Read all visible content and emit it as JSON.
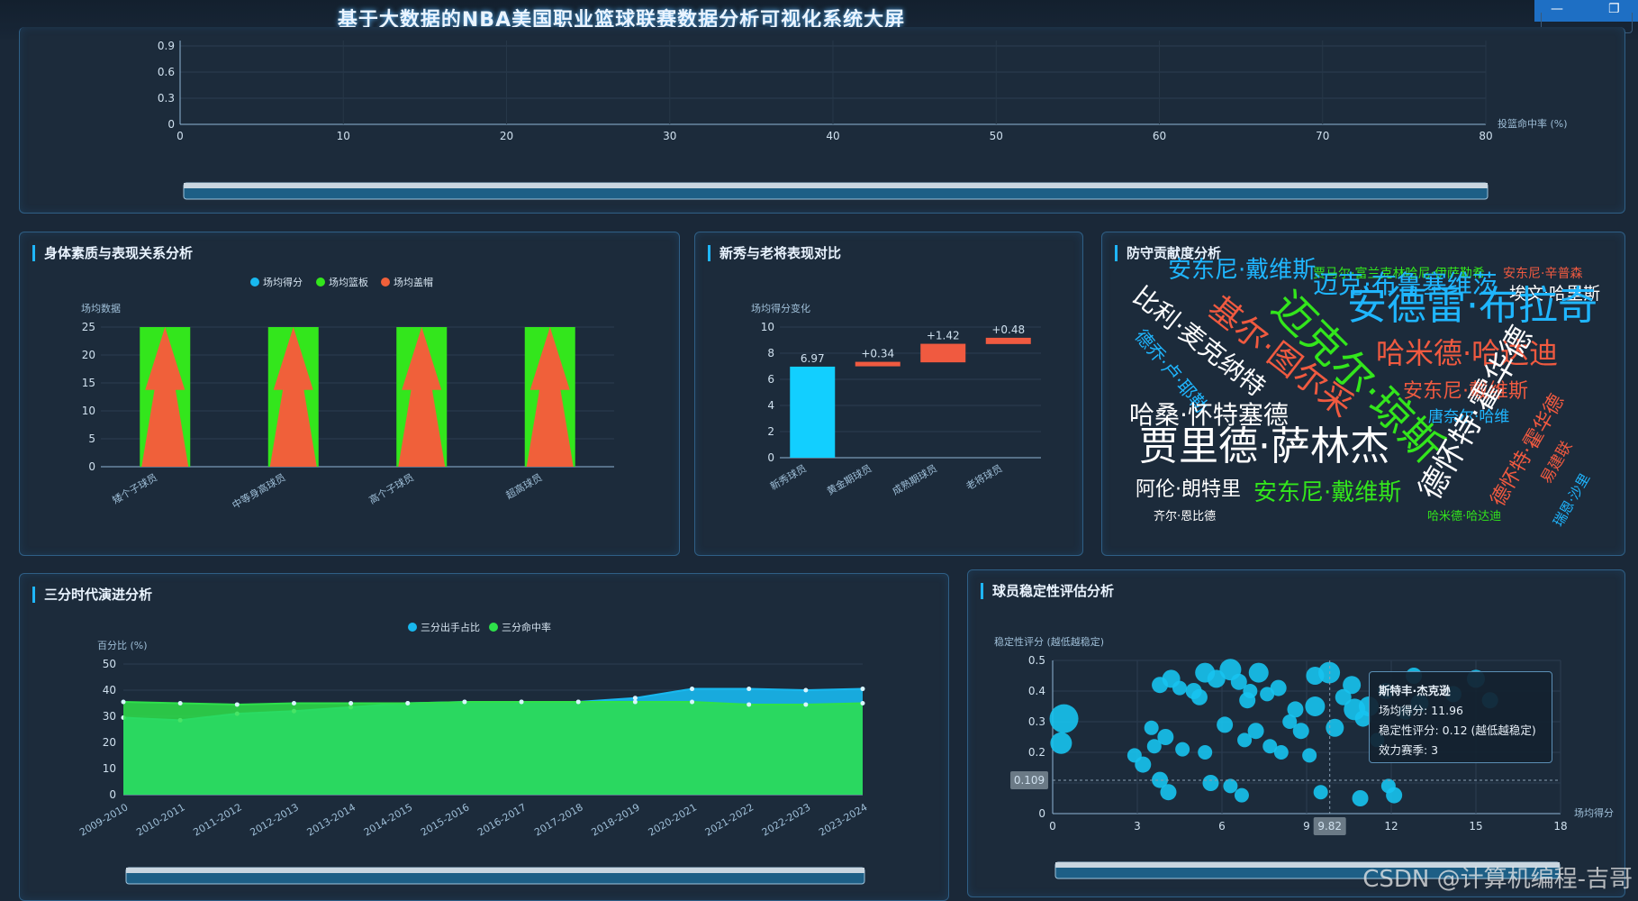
{
  "title": "基于大数据的NBA美国职业篮球联赛数据分析可视化系统大屏",
  "window": {
    "minimize": "—",
    "maximize": "❐"
  },
  "watermark": "CSDN @计算机编程-吉哥",
  "top_panel": {
    "chart_data": {
      "type": "scatter",
      "xlabel": "投篮命中率 (%)",
      "xticks": [
        "0",
        "10",
        "20",
        "30",
        "40",
        "50",
        "60",
        "70",
        "80"
      ],
      "yticks": [
        "0",
        "0.3",
        "0.6",
        "0.9"
      ],
      "xlim": [
        0,
        80
      ]
    }
  },
  "physical": {
    "title": "身体素质与表现关系分析",
    "chart_data": {
      "type": "bar",
      "ylabel": "场均数据",
      "categories": [
        "矮个子球员",
        "中等身高球员",
        "高个子球员",
        "超高球员"
      ],
      "series": [
        {
          "name": "场均得分",
          "values": [
            25,
            25,
            25,
            25
          ]
        },
        {
          "name": "场均篮板",
          "values": [
            25,
            25,
            25,
            25
          ]
        },
        {
          "name": "场均盖帽",
          "values": [
            25,
            25,
            25,
            25
          ]
        }
      ],
      "yticks": [
        "0",
        "5",
        "10",
        "15",
        "20",
        "25"
      ],
      "ylim": [
        0,
        25
      ],
      "colors": [
        "#18b8ef",
        "#33e61c",
        "#f0603a"
      ]
    }
  },
  "rookie": {
    "title": "新秀与老将表现对比",
    "chart_data": {
      "type": "bar",
      "ylabel": "场均得分变化",
      "categories": [
        "新秀球员",
        "黄金期球员",
        "成熟期球员",
        "老将球员"
      ],
      "bases": [
        0,
        7.0,
        7.3,
        8.7
      ],
      "values": [
        6.97,
        0.34,
        1.42,
        0.48
      ],
      "labels": [
        "6.97",
        "+0.34",
        "+1.42",
        "+0.48"
      ],
      "yticks": [
        "0",
        "2",
        "4",
        "6",
        "8",
        "10"
      ],
      "ylim": [
        0,
        10
      ],
      "colors": [
        "#12cfff",
        "#f05a40"
      ]
    }
  },
  "defense": {
    "title": "防守贡献度分析",
    "words": [
      {
        "text": "安东尼·戴维斯",
        "x": 1297,
        "y": 313,
        "s": 26,
        "c": "#1fb6ff",
        "r": 0
      },
      {
        "text": "贾马尔·富兰克林哈尼·伊萨勒希",
        "x": 1458,
        "y": 311,
        "s": 14,
        "c": "#33e61c",
        "r": 0
      },
      {
        "text": "安东尼·辛普森",
        "x": 1669,
        "y": 311,
        "s": 14,
        "c": "#f05a40",
        "r": 0
      },
      {
        "text": "迈克·布鲁塞维茨",
        "x": 1458,
        "y": 330,
        "s": 28,
        "c": "#1fb6ff",
        "r": 0
      },
      {
        "text": "埃文·哈里斯",
        "x": 1676,
        "y": 336,
        "s": 19,
        "c": "#ffffff",
        "r": 0
      },
      {
        "text": "安德雷·布拉奇",
        "x": 1496,
        "y": 362,
        "s": 44,
        "c": "#1fb6ff",
        "r": 0
      },
      {
        "text": "比利·麦克纳特",
        "x": 1253,
        "y": 336,
        "s": 28,
        "c": "#ffffff",
        "r": 38
      },
      {
        "text": "基尔·图尔采",
        "x": 1335,
        "y": 352,
        "s": 36,
        "c": "#f05a40",
        "r": 38
      },
      {
        "text": "迈克尔·琼斯",
        "x": 1405,
        "y": 348,
        "s": 46,
        "c": "#33e61c",
        "r": 45
      },
      {
        "text": "德乔·卢·耶勒",
        "x": 1257,
        "y": 375,
        "s": 20,
        "c": "#1fb6ff",
        "r": 50
      },
      {
        "text": "哈米德·哈达迪",
        "x": 1528,
        "y": 408,
        "s": 32,
        "c": "#f05a40",
        "r": 0
      },
      {
        "text": "安东尼·戴维斯",
        "x": 1558,
        "y": 446,
        "s": 22,
        "c": "#f05a40",
        "r": 0
      },
      {
        "text": "唐奈尔·哈维",
        "x": 1586,
        "y": 472,
        "s": 17,
        "c": "#1fb6ff",
        "r": 0
      },
      {
        "text": "德怀特·霍华德",
        "x": 1600,
        "y": 560,
        "s": 34,
        "c": "#ffffff",
        "r": -60
      },
      {
        "text": "德怀特·霍华德",
        "x": 1672,
        "y": 566,
        "s": 22,
        "c": "#f05a40",
        "r": -60
      },
      {
        "text": "易建联",
        "x": 1724,
        "y": 540,
        "s": 17,
        "c": "#f05a40",
        "r": -60
      },
      {
        "text": "瑞恩·沙里",
        "x": 1736,
        "y": 587,
        "s": 15,
        "c": "#1fb6ff",
        "r": -60
      },
      {
        "text": "哈桑·怀特塞德",
        "x": 1254,
        "y": 475,
        "s": 28,
        "c": "#ffffff",
        "r": 0
      },
      {
        "text": "贾里德·萨林杰",
        "x": 1265,
        "y": 518,
        "s": 44,
        "c": "#ffffff",
        "r": 0
      },
      {
        "text": "阿伦·朗特里",
        "x": 1261,
        "y": 555,
        "s": 22,
        "c": "#ffffff",
        "r": 0
      },
      {
        "text": "安东尼·戴维斯",
        "x": 1392,
        "y": 560,
        "s": 26,
        "c": "#33e61c",
        "r": 0
      },
      {
        "text": "齐尔·恩比德",
        "x": 1281,
        "y": 580,
        "s": 13,
        "c": "#ffffff",
        "r": 0
      },
      {
        "text": "哈米德·哈达迪",
        "x": 1585,
        "y": 580,
        "s": 13,
        "c": "#33e61c",
        "r": 0
      }
    ]
  },
  "threept": {
    "title": "三分时代演进分析",
    "chart_data": {
      "type": "area",
      "ylabel": "百分比 (%)",
      "categories": [
        "2009-2010",
        "2010-2011",
        "2011-2012",
        "2012-2013",
        "2013-2014",
        "2014-2015",
        "2015-2016",
        "2016-2017",
        "2017-2018",
        "2018-2019",
        "2020-2021",
        "2021-2022",
        "2022-2023",
        "2023-2024"
      ],
      "series": [
        {
          "name": "三分出手占比",
          "values": [
            29.5,
            28.5,
            31,
            32,
            33.5,
            35,
            35.5,
            35.5,
            35.5,
            37,
            40.5,
            40.5,
            40,
            40.5
          ]
        },
        {
          "name": "三分命中率",
          "values": [
            35.5,
            35,
            34.5,
            35,
            35,
            35,
            35.5,
            35.5,
            35.5,
            35.5,
            35.5,
            34.5,
            34.5,
            35
          ]
        }
      ],
      "yticks": [
        "0",
        "10",
        "20",
        "30",
        "40",
        "50"
      ],
      "ylim": [
        0,
        50
      ],
      "colors": [
        "#18b8ef",
        "#2ee04a"
      ]
    }
  },
  "stability": {
    "title": "球员稳定性评估分析",
    "chart_data": {
      "type": "scatter",
      "ylabel": "稳定性评分 (越低越稳定)",
      "xlabel": "场均得分",
      "xticks": [
        "0",
        "3",
        "6",
        "9",
        "12",
        "15",
        "18"
      ],
      "yticks": [
        "0",
        "0.1",
        "0.2",
        "0.3",
        "0.4",
        "0.5"
      ],
      "xlim": [
        0,
        18
      ],
      "ylim": [
        0,
        0.5
      ],
      "crosshair": {
        "x": 9.82,
        "y": 0.109,
        "xlabel": "9.82",
        "ylabel": "0.109"
      },
      "points": [
        [
          0.4,
          0.31,
          16
        ],
        [
          0.3,
          0.23,
          12
        ],
        [
          3.8,
          0.42,
          9
        ],
        [
          4.2,
          0.44,
          10
        ],
        [
          4.5,
          0.41,
          8
        ],
        [
          5.0,
          0.4,
          9
        ],
        [
          5.4,
          0.46,
          11
        ],
        [
          5.8,
          0.44,
          10
        ],
        [
          5.2,
          0.38,
          9
        ],
        [
          6.3,
          0.47,
          12
        ],
        [
          6.6,
          0.43,
          9
        ],
        [
          7.0,
          0.4,
          8
        ],
        [
          7.3,
          0.46,
          11
        ],
        [
          6.9,
          0.37,
          9
        ],
        [
          7.6,
          0.39,
          8
        ],
        [
          8.0,
          0.41,
          9
        ],
        [
          8.4,
          0.3,
          8
        ],
        [
          8.8,
          0.27,
          9
        ],
        [
          9.3,
          0.45,
          10
        ],
        [
          9.8,
          0.46,
          12
        ],
        [
          10.3,
          0.38,
          9
        ],
        [
          10.6,
          0.42,
          10
        ],
        [
          11.2,
          0.35,
          11
        ],
        [
          11.8,
          0.4,
          9
        ],
        [
          12.5,
          0.33,
          8
        ],
        [
          13.0,
          0.36,
          10
        ],
        [
          14.2,
          0.39,
          9
        ],
        [
          15.0,
          0.44,
          10
        ],
        [
          15.5,
          0.37,
          9
        ],
        [
          3.5,
          0.28,
          8
        ],
        [
          3.6,
          0.22,
          8
        ],
        [
          4.0,
          0.25,
          9
        ],
        [
          4.6,
          0.21,
          8
        ],
        [
          5.4,
          0.2,
          8
        ],
        [
          6.1,
          0.29,
          9
        ],
        [
          6.8,
          0.24,
          8
        ],
        [
          7.2,
          0.27,
          9
        ],
        [
          7.7,
          0.22,
          8
        ],
        [
          8.6,
          0.34,
          9
        ],
        [
          9.1,
          0.19,
          8
        ],
        [
          10.0,
          0.28,
          10
        ],
        [
          11.0,
          0.31,
          9
        ],
        [
          11.5,
          0.24,
          8
        ],
        [
          3.8,
          0.11,
          9
        ],
        [
          4.1,
          0.07,
          9
        ],
        [
          5.6,
          0.1,
          9
        ],
        [
          6.3,
          0.09,
          8
        ],
        [
          6.7,
          0.06,
          8
        ],
        [
          9.5,
          0.07,
          8
        ],
        [
          10.9,
          0.05,
          9
        ],
        [
          11.9,
          0.09,
          8
        ],
        [
          12.1,
          0.06,
          9
        ],
        [
          2.9,
          0.19,
          8
        ],
        [
          3.2,
          0.16,
          9
        ],
        [
          8.1,
          0.2,
          8
        ],
        [
          9.3,
          0.35,
          11
        ],
        [
          10.7,
          0.34,
          12
        ],
        [
          12.8,
          0.45,
          9
        ]
      ]
    },
    "tooltip": {
      "name": "斯特丰·杰克逊",
      "score": "场均得分: 11.96",
      "stab": "稳定性评分: 0.12 (越低越稳定)",
      "seasons": "效力赛季: 3"
    }
  }
}
